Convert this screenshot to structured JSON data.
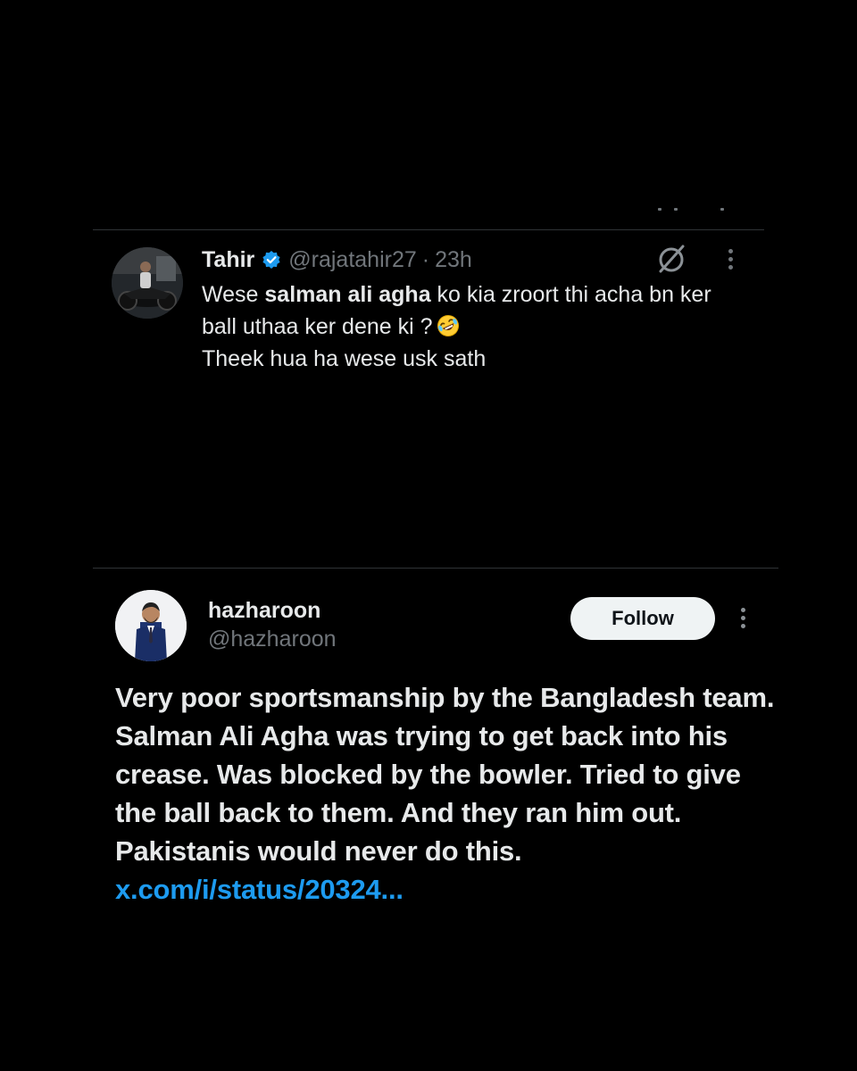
{
  "tweet1": {
    "display_name": "Tahir",
    "handle": "@rajatahir27",
    "separator": "·",
    "time": "23h",
    "text_prefix": "Wese ",
    "mention": "salman ali agha",
    "text_line1_rest": " ko kia zroort thi acha bn ker",
    "text_line2": "ball uthaa ker dene ki ?",
    "emoji": "rolling-on-floor-laughing",
    "text_line3": "Theek hua ha wese usk sath"
  },
  "tweet2": {
    "display_name": "hazharoon",
    "handle": "@hazharoon",
    "follow_label": "Follow",
    "body": "Very poor sportsmanship by the Bangladesh team. Salman Ali Agha was trying to get back into his crease. Was blocked by the bowler. Tried to give the ball back to them. And they ran him out. Pakistanis would never do this. ",
    "link": "x.com/i/status/20324..."
  },
  "colors": {
    "background": "#000000",
    "text_primary": "#e7e9ea",
    "text_secondary": "#71767b",
    "link": "#1d9bf0",
    "verified_badge": "#1d9bf0",
    "divider": "#2f3336",
    "follow_button_bg": "#eff3f4"
  },
  "icons": [
    "verified-badge-icon",
    "grok-icon",
    "more-options-icon"
  ]
}
